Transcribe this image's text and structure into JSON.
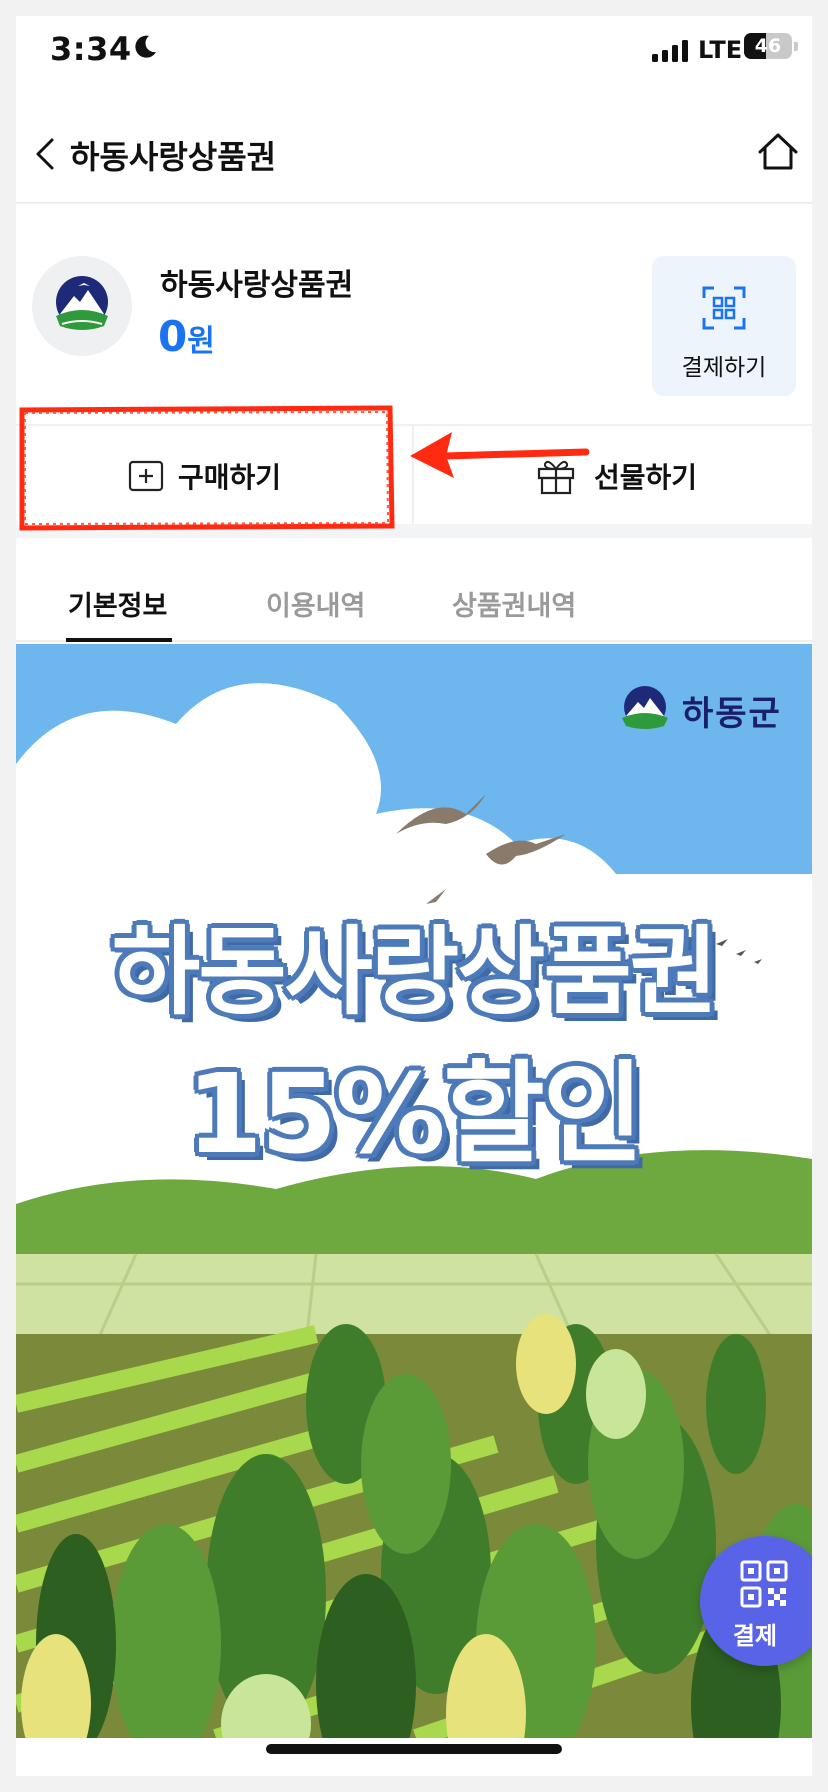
{
  "status_bar": {
    "time": "3:34",
    "network": "LTE",
    "battery": "46",
    "battery_level": 0.46
  },
  "nav": {
    "title": "하동사랑상품권"
  },
  "card": {
    "name": "하동사랑상품권",
    "balance_amount": "0",
    "balance_unit": "원",
    "pay_label": "결제하기"
  },
  "actions": {
    "buy_label": "구매하기",
    "gift_label": "선물하기"
  },
  "tabs": [
    {
      "label": "기본정보",
      "active": true
    },
    {
      "label": "이용내역",
      "active": false
    },
    {
      "label": "상품권내역",
      "active": false
    }
  ],
  "banner": {
    "brand": "하동군",
    "headline_line1": "하동사랑상품권",
    "headline_line2": "15%할인"
  },
  "fab": {
    "label": "결제"
  },
  "colors": {
    "accent_blue": "#1a73f0",
    "fab_purple": "#5863e8",
    "annotation_red": "#ff2a12"
  },
  "icons": [
    "moon-icon",
    "signal-icon",
    "back-icon",
    "home-icon",
    "qr-scan-icon",
    "plus-square-icon",
    "gift-icon",
    "qr-code-icon"
  ]
}
